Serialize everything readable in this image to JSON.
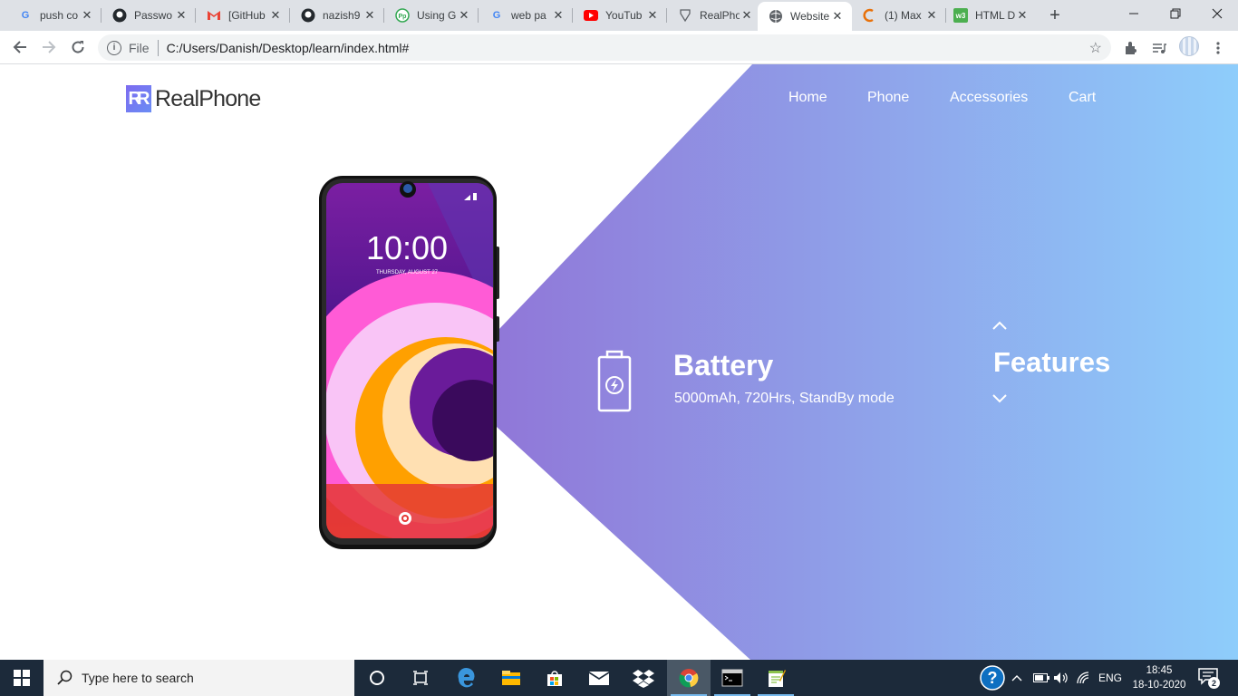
{
  "browser": {
    "tabs": [
      {
        "title": "push co",
        "icon": "google-icon"
      },
      {
        "title": "Passwo",
        "icon": "github-icon"
      },
      {
        "title": "[GitHub",
        "icon": "gmail-icon"
      },
      {
        "title": "nazish9",
        "icon": "github-icon"
      },
      {
        "title": "Using G",
        "icon": "app-icon"
      },
      {
        "title": "web pa",
        "icon": "google-icon"
      },
      {
        "title": "YouTub",
        "icon": "youtube-icon"
      },
      {
        "title": "RealPho",
        "icon": "page-icon"
      },
      {
        "title": "Website",
        "icon": "globe-icon",
        "active": true
      },
      {
        "title": "(1) Max",
        "icon": "site-icon"
      },
      {
        "title": "HTML D",
        "icon": "w3-icon"
      }
    ],
    "url_scheme": "File",
    "url": "C:/Users/Danish/Desktop/learn/index.html#"
  },
  "site": {
    "brand": "RealPhone",
    "logo_mark": "R",
    "nav": [
      "Home",
      "Phone",
      "Accessories",
      "Cart"
    ],
    "phone_screen": {
      "time": "10:00",
      "date": "THURSDAY, AUGUST 27"
    },
    "feature": {
      "title": "Battery",
      "description": "5000mAh, 720Hrs, StandBy mode"
    },
    "section_title": "Features",
    "colors": {
      "accent_start": "#9077d8",
      "accent_end": "#8ecdfb"
    }
  },
  "taskbar": {
    "search_placeholder": "Type here to search",
    "language": "ENG",
    "time": "18:45",
    "date": "18-10-2020",
    "notification_count": "2"
  }
}
